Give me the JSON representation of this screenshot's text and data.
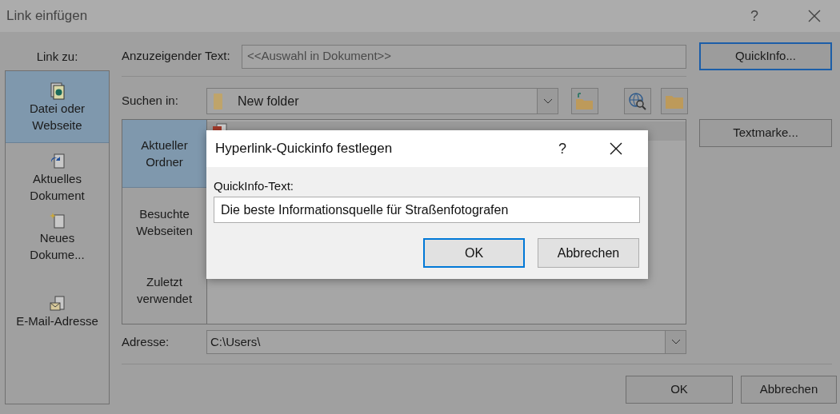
{
  "window": {
    "title": "Link einfügen",
    "help": "?"
  },
  "link_to": {
    "label": "Link zu:",
    "items": [
      {
        "label": "Datei oder Webseite",
        "kind": "file",
        "selected": true
      },
      {
        "label": "Aktuelles Dokument",
        "kind": "document",
        "selected": false
      },
      {
        "label": "Neues Dokume...",
        "kind": "new",
        "selected": false
      },
      {
        "label": "E-Mail-Adresse",
        "kind": "email",
        "selected": false
      }
    ]
  },
  "display_text": {
    "label": "Anzuzeigender Text:",
    "value": "<<Auswahl in Dokument>>"
  },
  "quickinfo_button": {
    "label": "QuickInfo...",
    "focused": true
  },
  "look_in": {
    "label": "Suchen in:",
    "value": "New folder"
  },
  "bookmark_button": {
    "label": "Textmarke..."
  },
  "nav": [
    {
      "label": "Aktueller Ordner",
      "selected": true
    },
    {
      "label": "Besuchte Webseiten",
      "selected": false
    },
    {
      "label": "Zuletzt verwendet",
      "selected": false
    }
  ],
  "address": {
    "label": "Adresse:",
    "value": "C:\\Users\\"
  },
  "buttons": [
    {
      "label": "OK"
    },
    {
      "label": "Abbrechen"
    }
  ],
  "modal": {
    "title": "Hyperlink-Quickinfo festlegen",
    "help": "?",
    "field_label": "QuickInfo-Text:",
    "value": "Die beste Informationsquelle für Straßenfotografen",
    "buttons": [
      {
        "label": "OK",
        "focused": true
      },
      {
        "label": "Abbrechen",
        "focused": false
      }
    ]
  }
}
